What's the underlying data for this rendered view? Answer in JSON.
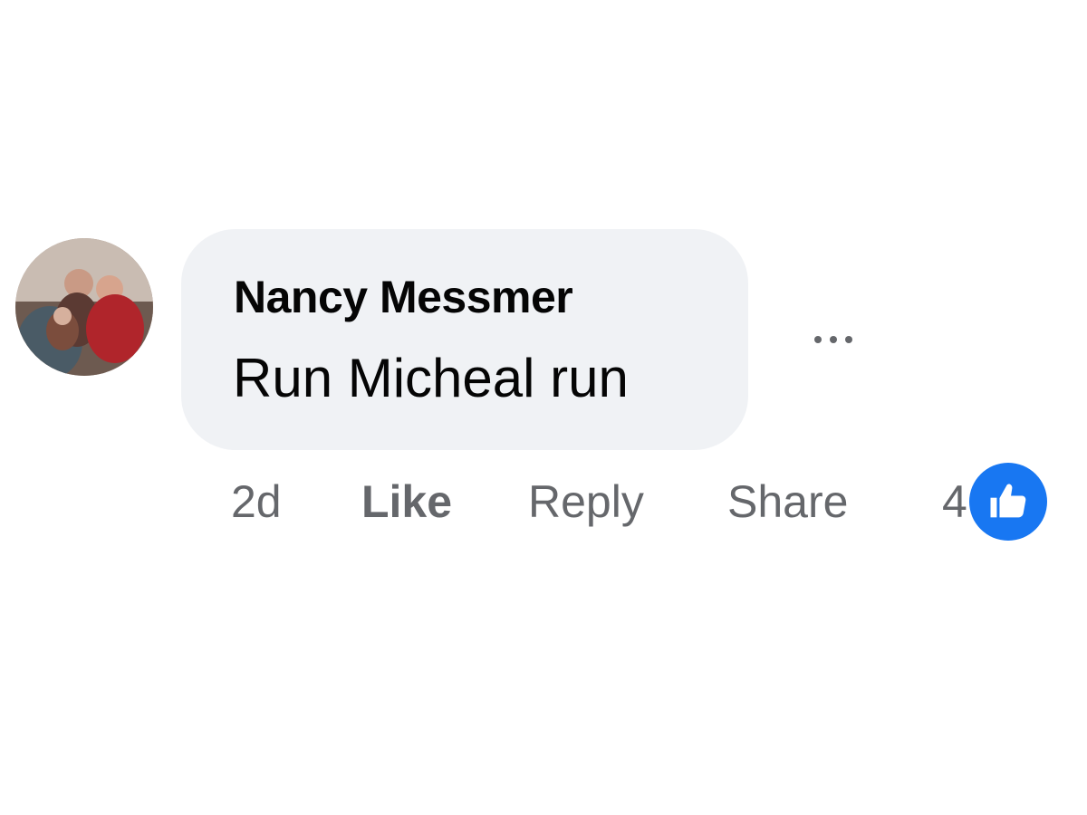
{
  "comment": {
    "author_name": "Nancy Messmer",
    "text": "Run Micheal run",
    "timestamp": "2d",
    "avatar_icon": "avatar-photo"
  },
  "actions": {
    "like_label": "Like",
    "reply_label": "Reply",
    "share_label": "Share"
  },
  "reactions": {
    "count": "4",
    "icon": "thumbs-up-icon",
    "badge_color": "#1877f2"
  },
  "more_options": {
    "icon": "more-options-icon"
  },
  "colors": {
    "bubble_background": "#f0f2f5",
    "primary_text": "#050505",
    "secondary_text": "#65676b"
  }
}
